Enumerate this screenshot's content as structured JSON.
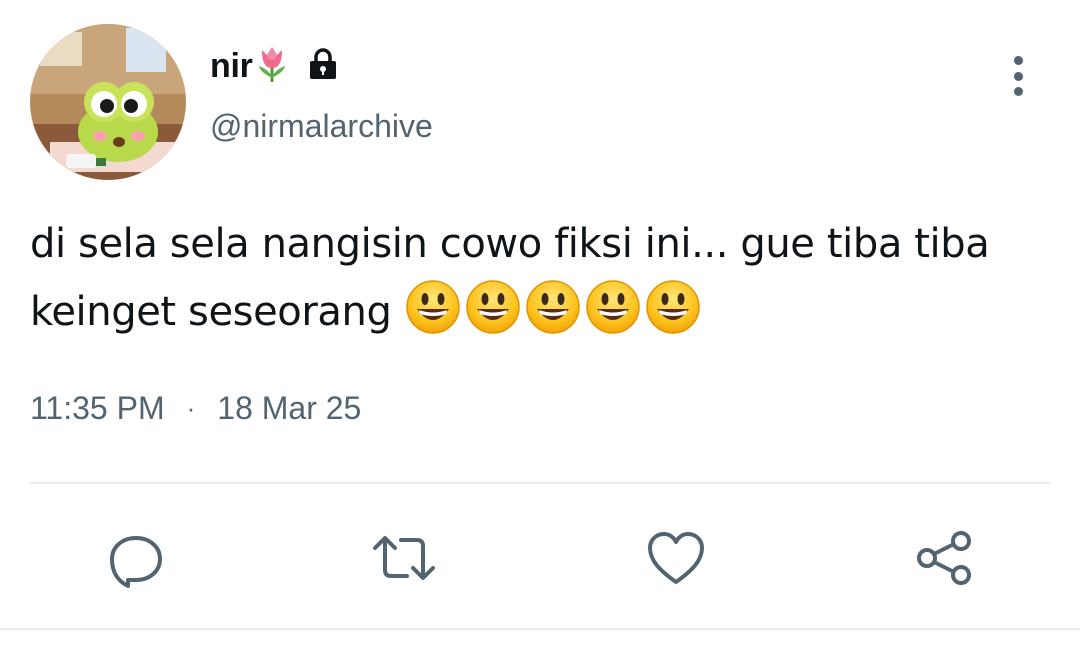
{
  "user": {
    "display_name": "nir",
    "display_name_emoji": "tulip-emoji",
    "protected_icon": "lock-icon",
    "handle": "@nirmalarchive"
  },
  "tweet": {
    "text": "di sela sela nangisin cowo fiksi ini... gue tiba tiba keinget seseorang",
    "emojis": [
      "😃",
      "😃",
      "😃",
      "😃",
      "😃"
    ],
    "time": "11:35 PM",
    "separator": "·",
    "date": "18 Mar 25"
  },
  "actions": [
    {
      "name": "reply",
      "icon": "reply-icon"
    },
    {
      "name": "retweet",
      "icon": "retweet-icon"
    },
    {
      "name": "like",
      "icon": "heart-icon"
    },
    {
      "name": "share",
      "icon": "share-icon"
    }
  ],
  "menu": {
    "icon": "more-vertical-icon"
  },
  "colors": {
    "text": "#0f1419",
    "secondary": "#536471",
    "divider": "#e6ecf0"
  }
}
